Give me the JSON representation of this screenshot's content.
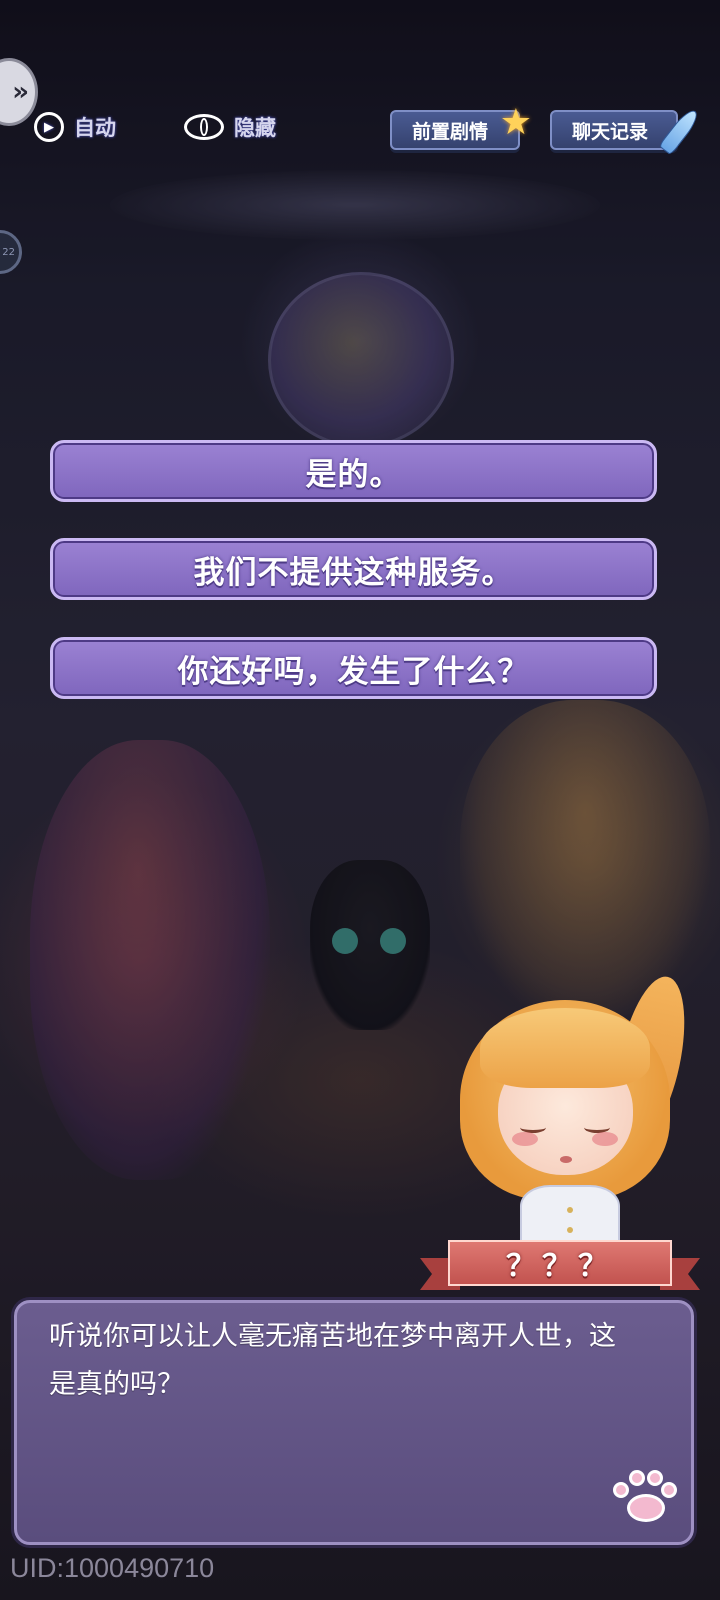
{
  "controls": {
    "auto_label": "自动",
    "hide_label": "隐藏",
    "prologue_label": "前置剧情",
    "chat_log_label": "聊天记录"
  },
  "level_badge": "22",
  "choices": [
    {
      "text": "是的。"
    },
    {
      "text": "我们不提供这种服务。"
    },
    {
      "text": "你还好吗，发生了什么？"
    }
  ],
  "speaker": {
    "name": "？？？"
  },
  "dialog": {
    "text": "听说你可以让人毫无痛苦地在梦中离开人世，这是真的吗？"
  },
  "footer": {
    "uid": "UID:1000490710"
  },
  "colors": {
    "choice_bg": "#8e75c9",
    "dialog_bg": "#625584",
    "ribbon": "#d1625d",
    "tag_button": "#3f4d80"
  },
  "icons": [
    "skip-icon",
    "play-icon",
    "eye-icon",
    "star-icon",
    "quill-icon",
    "paw-icon"
  ]
}
